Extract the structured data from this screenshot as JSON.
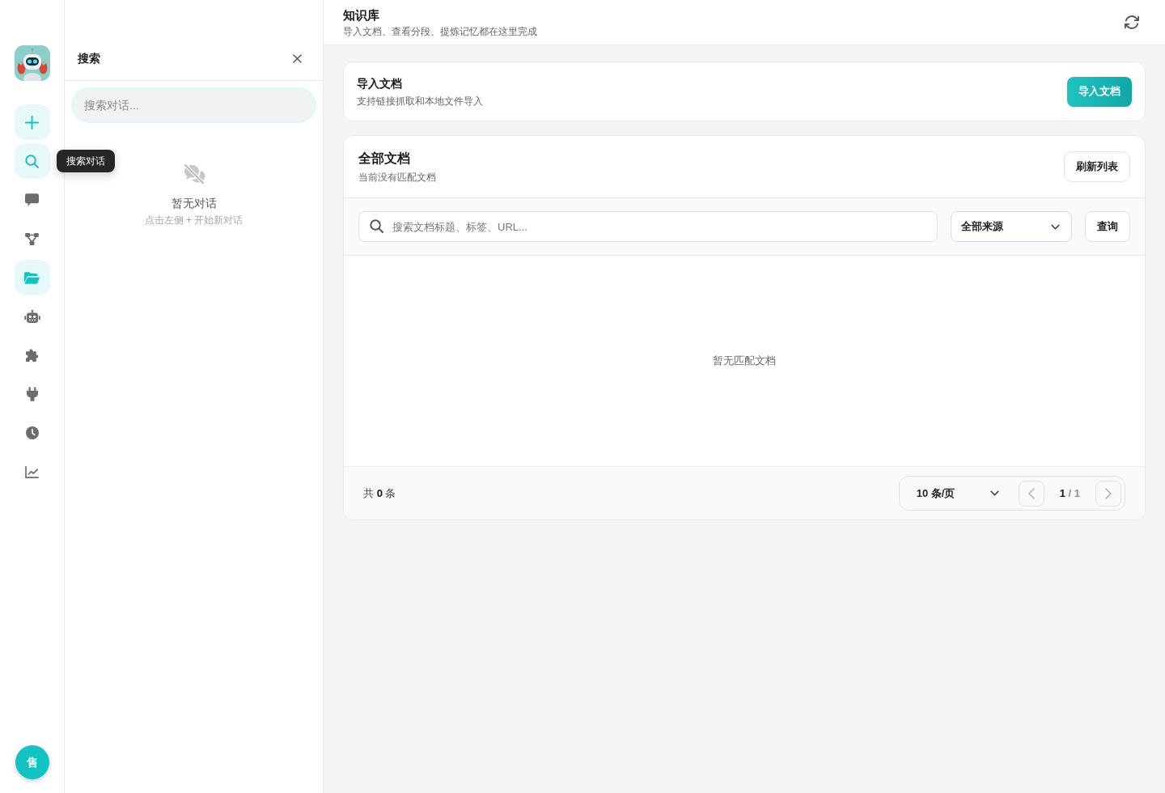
{
  "rail": {
    "items": [
      {
        "kind": "search",
        "selected": true,
        "tooltip": "搜索对话"
      },
      {
        "kind": "chat",
        "selected": false
      },
      {
        "kind": "flow",
        "selected": false
      },
      {
        "kind": "docs",
        "selected": true
      },
      {
        "kind": "bot",
        "selected": false
      },
      {
        "kind": "plugin",
        "selected": false
      },
      {
        "kind": "plug",
        "selected": false
      },
      {
        "kind": "history",
        "selected": false
      },
      {
        "kind": "stats",
        "selected": false
      }
    ],
    "avatar": "售"
  },
  "search_panel": {
    "title": "搜索",
    "search": {
      "placeholder": "搜索对话...",
      "focused": true
    },
    "empty": {
      "title": "暂无对话",
      "hint": "点击左侧 + 开始新对话"
    }
  },
  "header": {
    "title": "知识库",
    "subtitle": "导入文档、查看分段、提炼记忆都在这里完成"
  },
  "import_card": {
    "title": "导入文档",
    "description": "支持链接抓取和本地文件导入",
    "button": "导入文档"
  },
  "documents": {
    "title": "全部文档",
    "description": "当前没有匹配文档",
    "refresh_button": "刷新列表",
    "search": {
      "placeholder": "搜索文档标题、标签、URL..."
    },
    "source_filter": {
      "value": "全部来源"
    },
    "query_button": "查询",
    "empty": "暂无匹配文档",
    "total": "共 **0** 条",
    "pagination": {
      "page_size": "10 条/页",
      "page": "**1** / 1",
      "prev": {
        "disabled": true
      },
      "next": {
        "disabled": true
      }
    }
  }
}
